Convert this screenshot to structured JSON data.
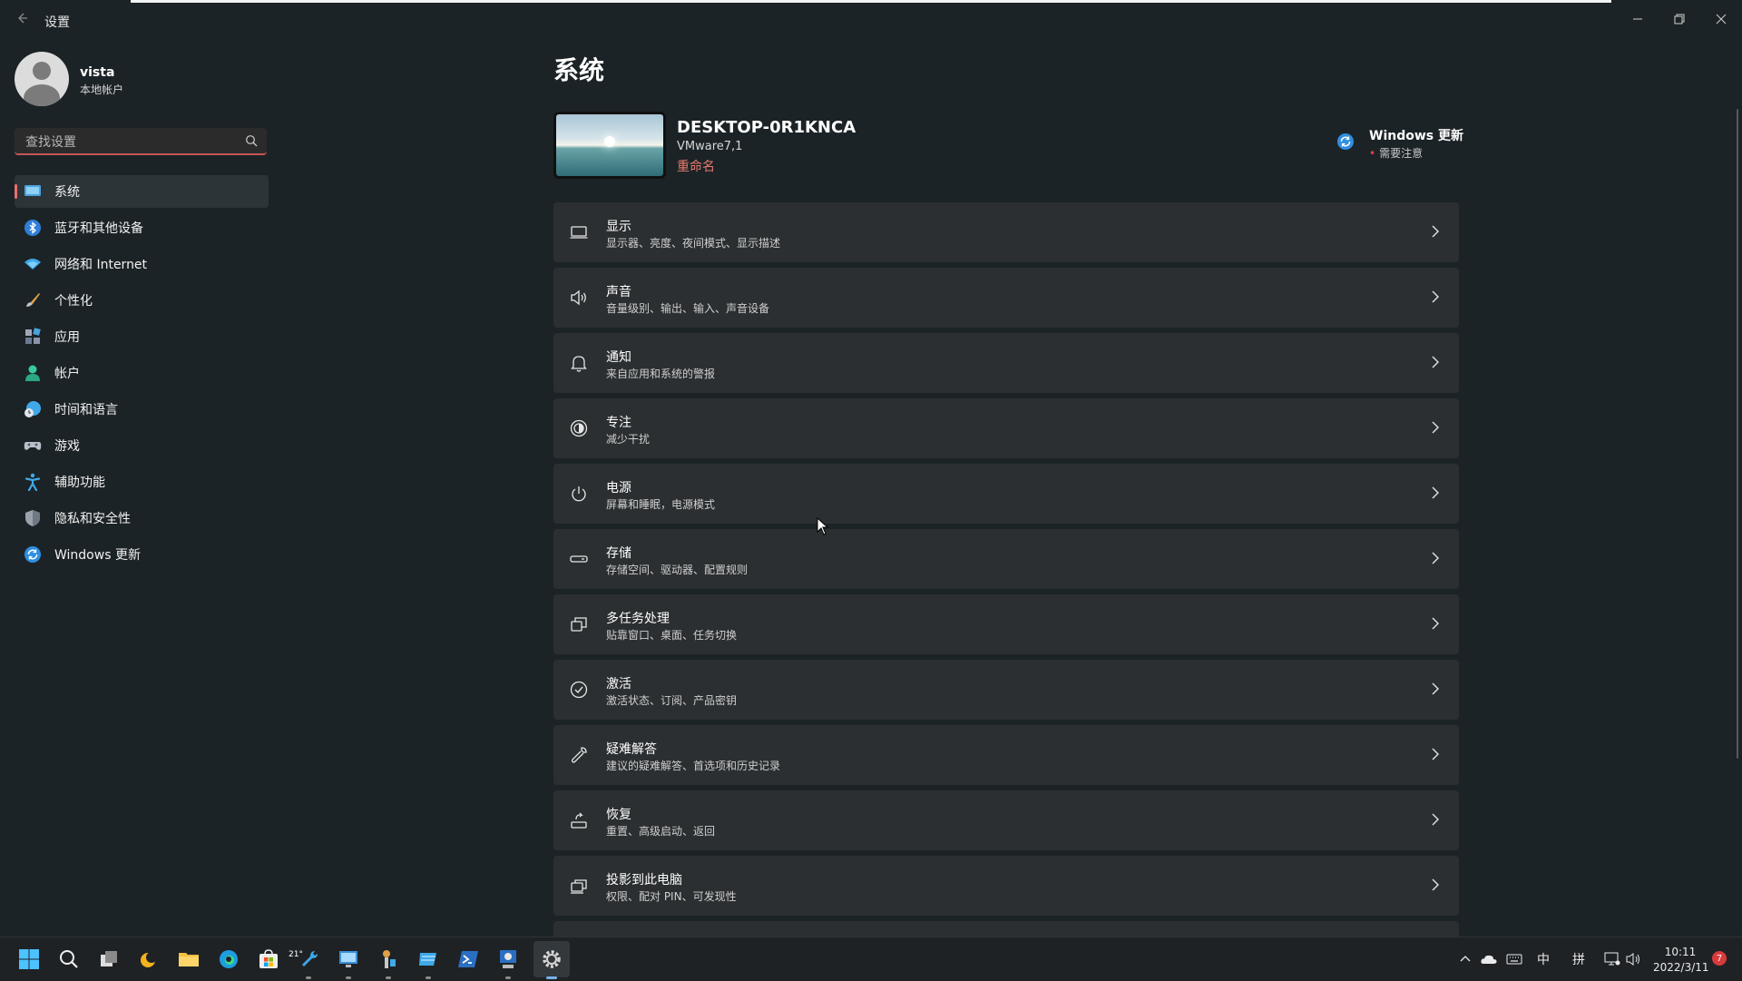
{
  "window": {
    "title": "设置"
  },
  "user": {
    "name": "vista",
    "type": "本地帐户"
  },
  "search": {
    "placeholder": "查找设置"
  },
  "sidebar": {
    "items": [
      {
        "label": "系统",
        "icon": "system-icon"
      },
      {
        "label": "蓝牙和其他设备",
        "icon": "bluetooth-icon"
      },
      {
        "label": "网络和 Internet",
        "icon": "wifi-icon"
      },
      {
        "label": "个性化",
        "icon": "brush-icon"
      },
      {
        "label": "应用",
        "icon": "apps-icon"
      },
      {
        "label": "帐户",
        "icon": "account-icon"
      },
      {
        "label": "时间和语言",
        "icon": "globe-clock-icon"
      },
      {
        "label": "游戏",
        "icon": "gamepad-icon"
      },
      {
        "label": "辅助功能",
        "icon": "accessibility-icon"
      },
      {
        "label": "隐私和安全性",
        "icon": "shield-icon"
      },
      {
        "label": "Windows 更新",
        "icon": "update-icon"
      }
    ]
  },
  "main": {
    "title": "系统",
    "device": {
      "name": "DESKTOP-0R1KNCA",
      "model": "VMware7,1",
      "rename": "重命名"
    },
    "update": {
      "title": "Windows 更新",
      "status": "需要注意"
    },
    "cards": [
      {
        "title": "显示",
        "subtitle": "显示器、亮度、夜间模式、显示描述",
        "icon": "monitor-icon"
      },
      {
        "title": "声音",
        "subtitle": "音量级别、输出、输入、声音设备",
        "icon": "speaker-icon"
      },
      {
        "title": "通知",
        "subtitle": "来自应用和系统的警报",
        "icon": "bell-icon"
      },
      {
        "title": "专注",
        "subtitle": "减少干扰",
        "icon": "focus-icon"
      },
      {
        "title": "电源",
        "subtitle": "屏幕和睡眠，电源模式",
        "icon": "power-icon"
      },
      {
        "title": "存储",
        "subtitle": "存储空间、驱动器、配置规则",
        "icon": "storage-icon"
      },
      {
        "title": "多任务处理",
        "subtitle": "贴靠窗口、桌面、任务切换",
        "icon": "multitask-icon"
      },
      {
        "title": "激活",
        "subtitle": "激活状态、订阅、产品密钥",
        "icon": "check-circle-icon"
      },
      {
        "title": "疑难解答",
        "subtitle": "建议的疑难解答、首选项和历史记录",
        "icon": "wrench-icon"
      },
      {
        "title": "恢复",
        "subtitle": "重置、高级启动、返回",
        "icon": "recovery-icon"
      },
      {
        "title": "投影到此电脑",
        "subtitle": "权限、配对 PIN、可发现性",
        "icon": "project-icon"
      }
    ]
  },
  "taskbar": {
    "weather_temp": "21°",
    "tray": {
      "ime1": "中",
      "ime2": "拼"
    },
    "time": "10:11",
    "date": "2022/3/11",
    "notifications": "7"
  },
  "colors": {
    "accent": "#e76f6f",
    "background": "#1c2326",
    "card": "#2b2f31"
  }
}
